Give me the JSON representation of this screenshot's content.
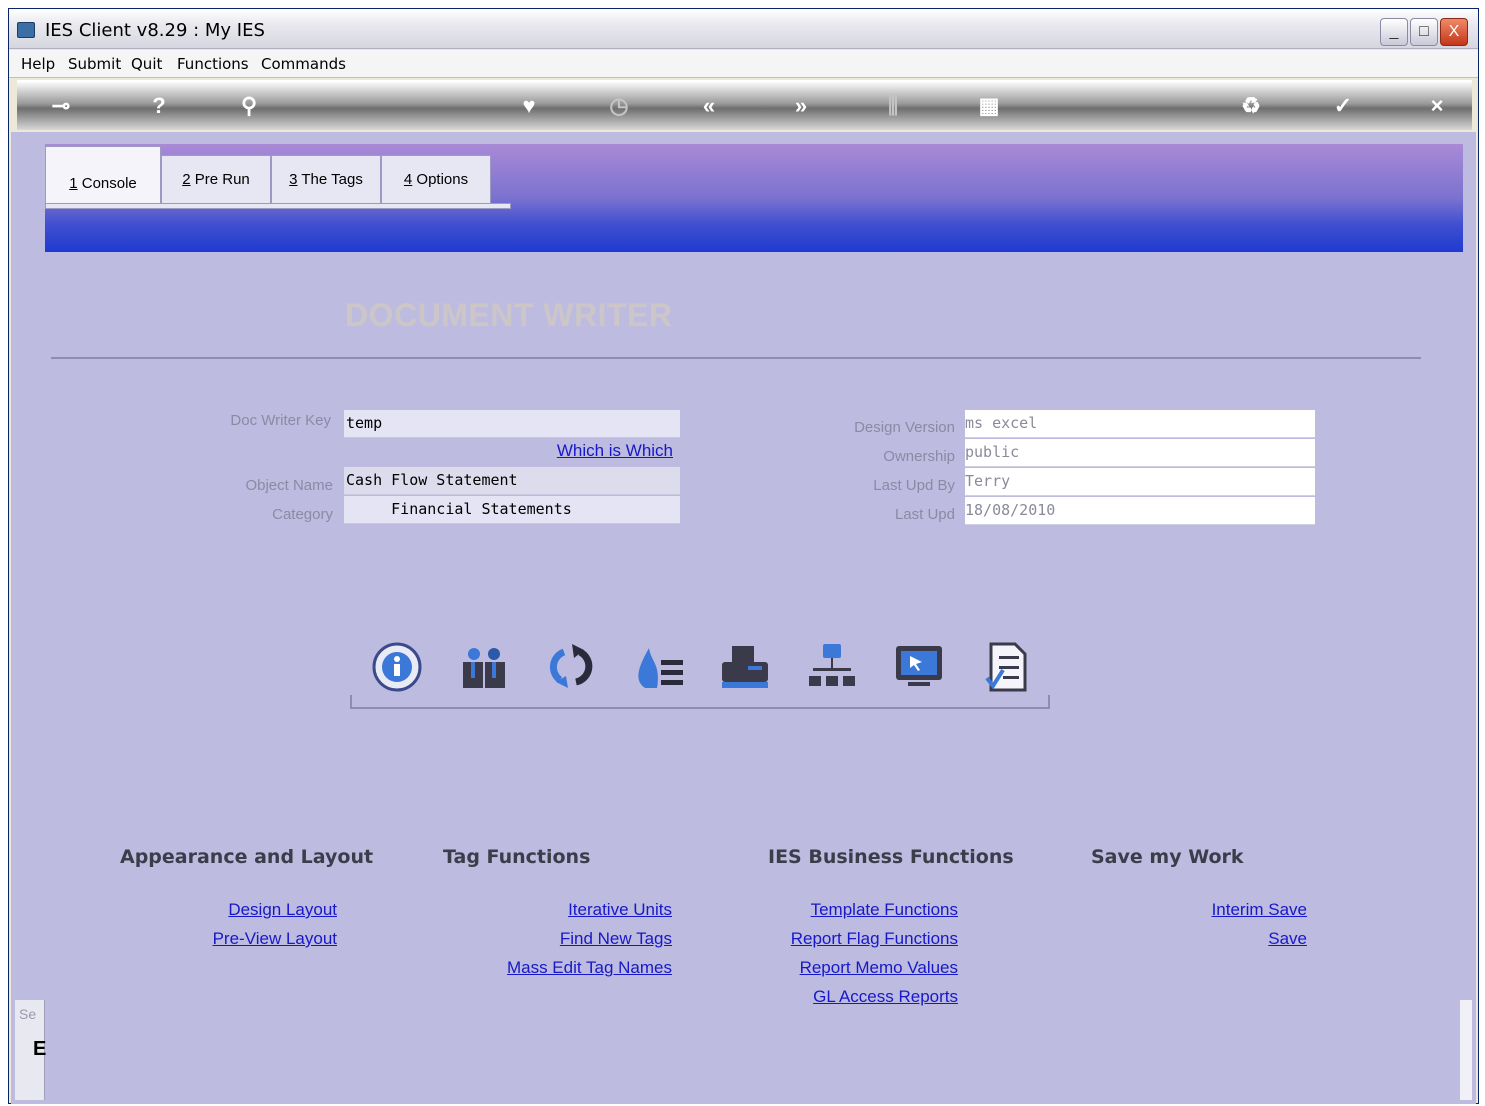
{
  "window": {
    "title": "IES Client v8.29 : My IES",
    "minimize": "_",
    "maximize": "□",
    "close": "X"
  },
  "menu": [
    "Help",
    "Submit",
    "Quit",
    "Functions",
    "Commands"
  ],
  "toolbar": {
    "icons": [
      "key-icon",
      "help-icon",
      "search-icon",
      "heart-icon",
      "clock-icon",
      "rewind-icon",
      "forward-icon",
      "columns-icon",
      "grid-icon",
      "recycle-icon",
      "check-icon",
      "close-icon"
    ]
  },
  "tabs": [
    {
      "num": "1",
      "label": " Console"
    },
    {
      "num": "2",
      "label": " Pre Run"
    },
    {
      "num": "3",
      "label": " The Tags"
    },
    {
      "num": "4",
      "label": " Options"
    }
  ],
  "form": {
    "title": "DOCUMENT WRITER",
    "doc_writer_key_label": "Doc Writer Key",
    "doc_writer_key": "temp",
    "which_is_which": "Which is Which",
    "object_name_label": "Object Name",
    "object_name": "Cash Flow Statement",
    "category_label": "Category",
    "category": "     Financial Statements",
    "design_version_label": "Design Version",
    "design_version": "ms excel",
    "ownership_label": "Ownership",
    "ownership": "public",
    "last_upd_by_label": "Last Upd By",
    "last_upd_by": "Terry",
    "last_upd_label": "Last Upd",
    "last_upd": "18/08/2010"
  },
  "action_icons": [
    "info-icon",
    "people-icon",
    "refresh-icon",
    "fire-list-icon",
    "printer-icon",
    "org-chart-icon",
    "monitor-icon",
    "checklist-document-icon"
  ],
  "sections": {
    "appearance": {
      "heading": "Appearance and Layout",
      "links": [
        "Design Layout",
        "Pre-View Layout"
      ]
    },
    "tags": {
      "heading": "Tag Functions",
      "links": [
        "Iterative Units",
        "Find New Tags",
        "Mass Edit Tag Names"
      ]
    },
    "business": {
      "heading": "IES Business Functions",
      "links": [
        "Template Functions",
        "Report Flag Functions",
        "Report Memo Values",
        "GL Access Reports"
      ]
    },
    "save": {
      "heading": "Save my Work",
      "links": [
        "Interim Save",
        "Save"
      ]
    }
  },
  "side_stub": {
    "text": "Se",
    "glyph": "E"
  },
  "colors": {
    "link": "#1818c8",
    "canvas": "#bdbce0",
    "band_top": "#a98ad6",
    "band_bottom": "#1f3ad0"
  }
}
